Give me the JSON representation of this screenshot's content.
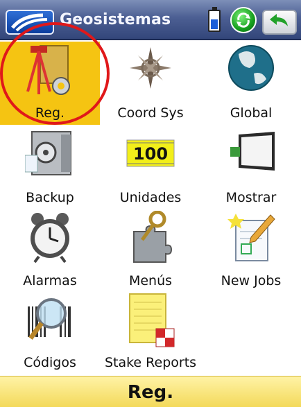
{
  "titlebar": {
    "title": "Geosistemas"
  },
  "grid": {
    "items": [
      {
        "label": "Reg.",
        "icon": "survey-tripod-gear-icon",
        "selected": true
      },
      {
        "label": "Coord Sys",
        "icon": "compass-rose-icon"
      },
      {
        "label": "Global",
        "icon": "globe-icon"
      },
      {
        "label": "Backup",
        "icon": "safe-vault-icon"
      },
      {
        "label": "Unidades",
        "icon": "ruler-100-icon",
        "ruler_value": "100"
      },
      {
        "label": "Mostrar",
        "icon": "display-monitor-icon"
      },
      {
        "label": "Alarmas",
        "icon": "alarm-clock-icon"
      },
      {
        "label": "Menús",
        "icon": "puzzle-key-icon"
      },
      {
        "label": "New Jobs",
        "icon": "new-document-pencil-icon"
      },
      {
        "label": "Códigos",
        "icon": "barcode-magnifier-icon"
      },
      {
        "label": "Stake Reports",
        "icon": "notepad-report-icon"
      }
    ]
  },
  "status": {
    "text": "Reg."
  },
  "colors": {
    "selected_bg": "#f5c412",
    "highlight_circle": "#e0181a",
    "status_bg": "#f3d95a",
    "titlebar_bg": "#4c5f93"
  }
}
